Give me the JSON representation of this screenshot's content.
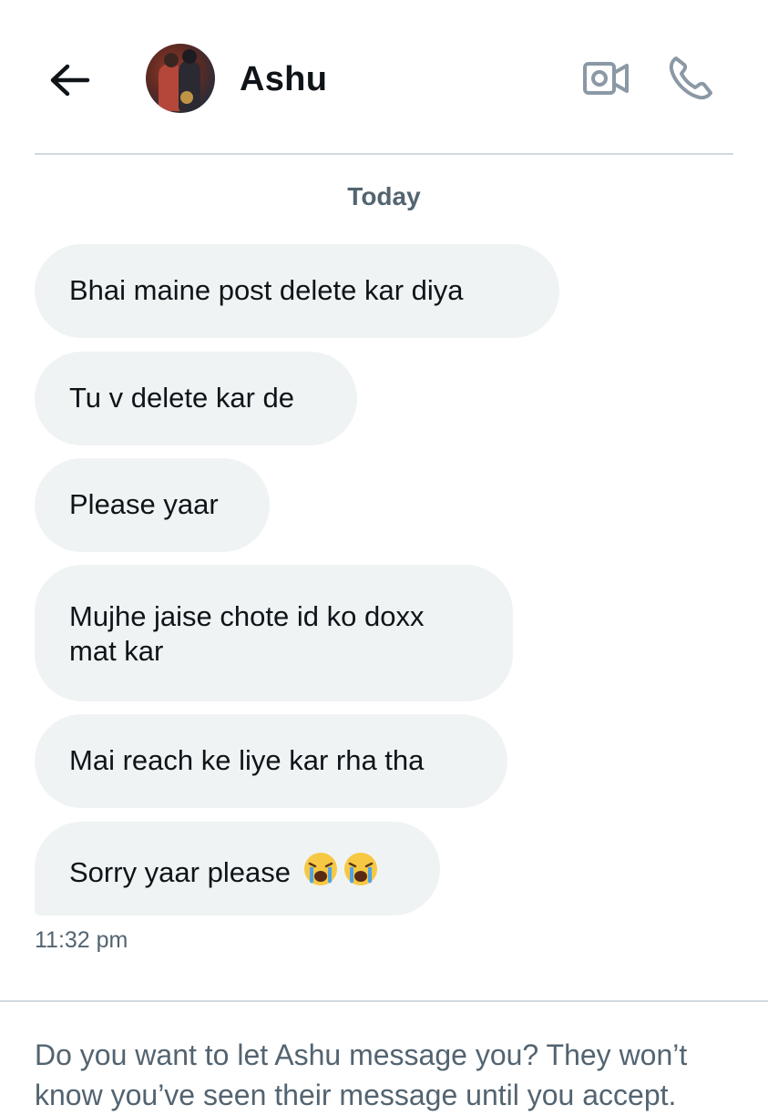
{
  "header": {
    "contact_name": "Ashu",
    "back_icon": "arrow-left-icon",
    "video_icon": "video-camera-icon",
    "call_icon": "phone-icon"
  },
  "conversation": {
    "date_label": "Today",
    "messages": [
      {
        "text": "Bhai maine post delete kar diya"
      },
      {
        "text": "Tu v delete kar de"
      },
      {
        "text": "Please yaar"
      },
      {
        "text": "Mujhe jaise chote id ko doxx mat kar"
      },
      {
        "text": "Mai reach ke liye kar rha tha"
      },
      {
        "text": "Sorry yaar please",
        "emoji": [
          "loudly-crying-face",
          "loudly-crying-face"
        ]
      }
    ],
    "timestamp": "11:32 pm"
  },
  "request_prompt": {
    "text": "Do you want to let Ashu message you? They won’t know you’ve seen their message until you accept."
  },
  "colors": {
    "bubble_bg": "#eff3f4",
    "text_primary": "#0f1419",
    "text_secondary": "#536471",
    "divider": "#cfd9de",
    "icon_gray": "#8b98a5"
  }
}
